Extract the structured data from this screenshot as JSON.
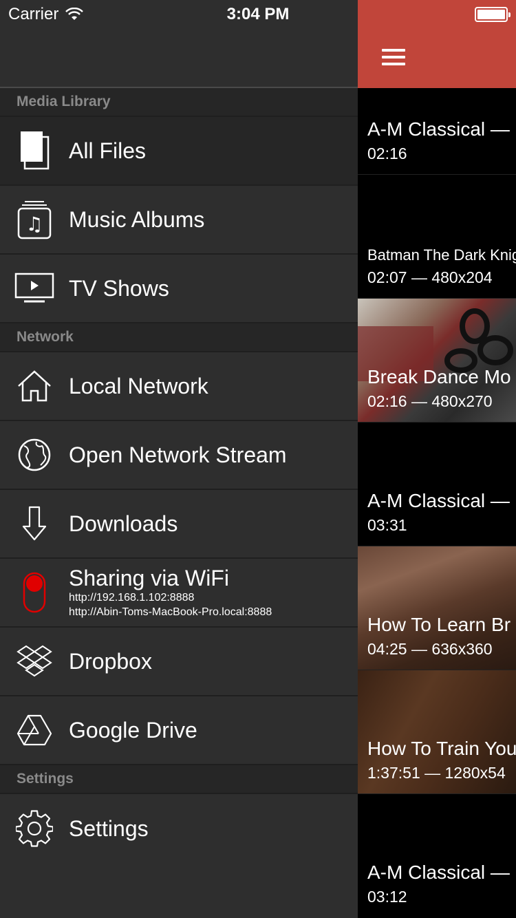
{
  "status_bar": {
    "carrier": "Carrier",
    "time": "3:04 PM"
  },
  "sidebar": {
    "sections": {
      "media_library": "Media Library",
      "network": "Network",
      "settings": "Settings"
    },
    "items": {
      "all_files": "All Files",
      "music_albums": "Music Albums",
      "tv_shows": "TV Shows",
      "local_network": "Local Network",
      "open_network_stream": "Open Network Stream",
      "downloads": "Downloads",
      "sharing_wifi": "Sharing via WiFi",
      "sharing_url_1": "http://192.168.1.102:8888",
      "sharing_url_2": "http://Abin-Toms-MacBook-Pro.local:8888",
      "dropbox": "Dropbox",
      "google_drive": "Google Drive",
      "settings": "Settings"
    }
  },
  "colors": {
    "accent": "#c1453a",
    "sidebar_bg": "#2e2e2e",
    "toggle_red": "#e00000"
  },
  "videos": [
    {
      "title": "A-M Classical —",
      "meta": "02:16"
    },
    {
      "title": "Batman The Dark Knig",
      "meta": "02:07 — 480x204"
    },
    {
      "title": "Break Dance Mo",
      "meta": "02:16 — 480x270"
    },
    {
      "title": "A-M Classical —",
      "meta": "03:31"
    },
    {
      "title": "How To Learn Br",
      "meta": "04:25 — 636x360"
    },
    {
      "title": "How To Train You",
      "meta": "1:37:51 — 1280x54"
    },
    {
      "title": "A-M Classical —",
      "meta": "03:12"
    }
  ]
}
